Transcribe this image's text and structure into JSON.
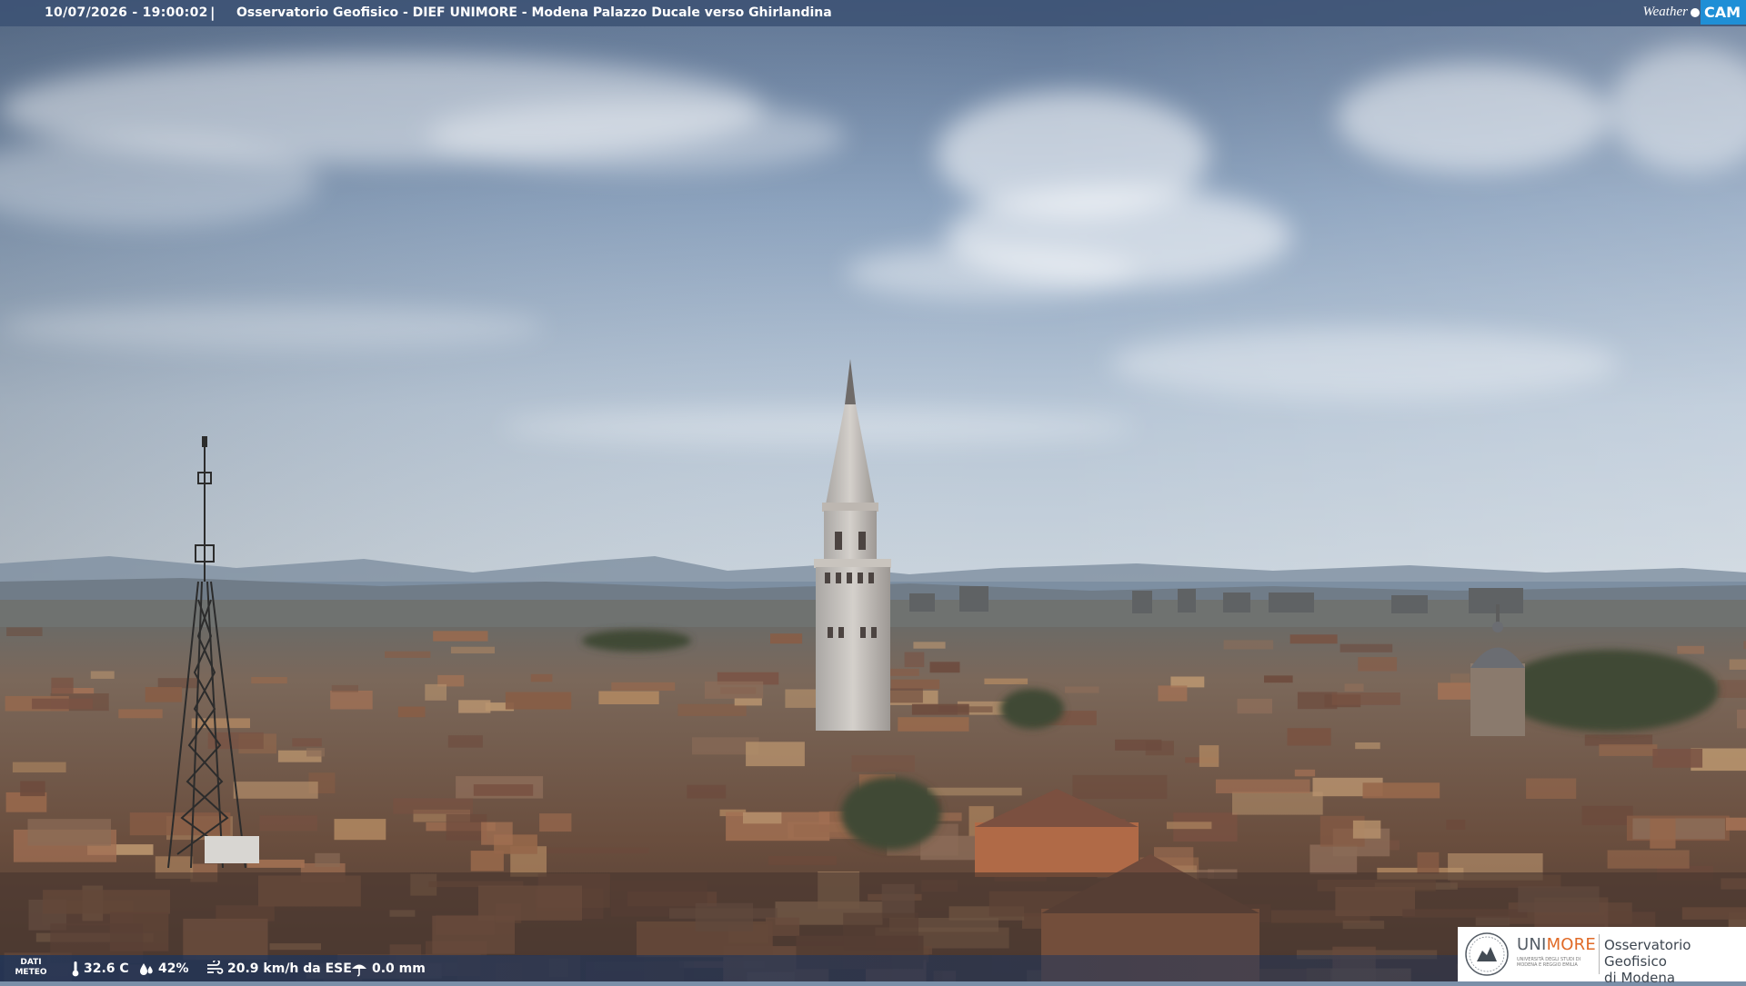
{
  "header": {
    "datetime": "10/07/2026 - 19:00:02",
    "separator": "|",
    "title": "Osservatorio Geofisico - DIEF UNIMORE - Modena Palazzo Ducale verso Ghirlandina"
  },
  "brand_logo": {
    "word1": "Weather",
    "word2": "CAM"
  },
  "weather_bar": {
    "label": "DATI METEO",
    "label_line1": "DATI",
    "label_line2": "METEO",
    "temperature": "32.6 C",
    "humidity": "42%",
    "wind": "20.9 km/h da ESE",
    "rain": "0.0 mm"
  },
  "institution_logo": {
    "uni_part1": "UNI",
    "uni_part2": "MORE",
    "uni_subtitle": "UNIVERSITÀ DEGLI STUDI DI MODENA E REGGIO EMILIA",
    "observatory_line1": "Osservatorio Geofisico",
    "observatory_line2": "di Modena"
  },
  "colors": {
    "accent_cam": "#1f8fd6",
    "accent_more": "#e06a27",
    "bar_blue": "#3c5274"
  },
  "icons": [
    "thermometer-icon",
    "humidity-drops-icon",
    "wind-icon",
    "rain-icon",
    "unimore-seal-icon"
  ]
}
